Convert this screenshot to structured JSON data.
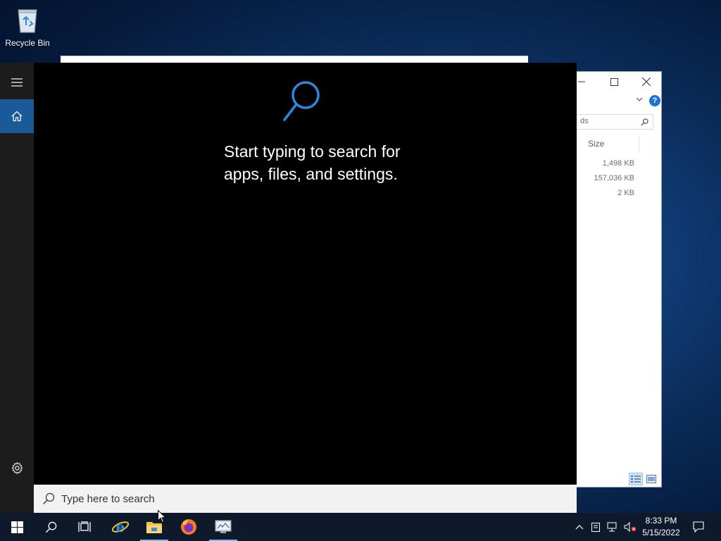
{
  "desktop": {
    "icons": [
      {
        "label": "Recycle Bin",
        "icon": "recycle-bin-icon"
      }
    ]
  },
  "explorer": {
    "search_placeholder_partial": "ds",
    "column_header": "Size",
    "sizes": [
      "1,498 KB",
      "157,036 KB",
      "2 KB"
    ],
    "help_label": "?"
  },
  "start_menu": {
    "hint": "Start typing to search for apps, files, and settings.",
    "rail": [
      "menu-icon",
      "home-icon",
      "settings-icon"
    ]
  },
  "search_bar": {
    "placeholder": "Type here to search"
  },
  "taskbar": {
    "apps": [
      "start-icon",
      "search-icon",
      "task-view-icon",
      "internet-explorer-icon",
      "file-explorer-icon",
      "firefox-icon",
      "server-manager-icon"
    ],
    "tray": [
      "show-hidden-icons-icon",
      "keyboard-icon",
      "network-icon",
      "volume-muted-icon"
    ],
    "time": "8:33 PM",
    "date": "5/15/2022"
  },
  "colors": {
    "accent": "#1a5a98",
    "taskbar": "#0e1a2c",
    "start_bg": "#000000"
  }
}
